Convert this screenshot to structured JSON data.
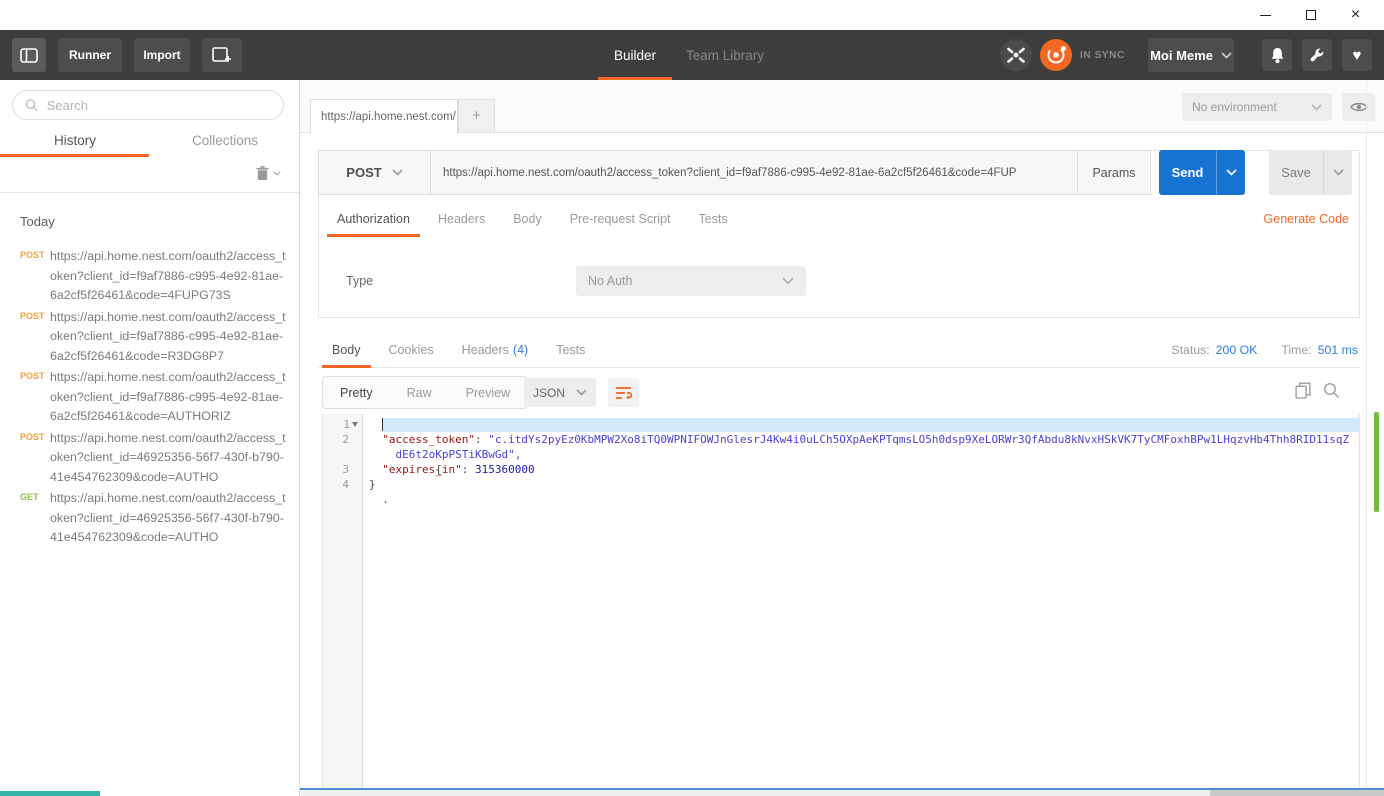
{
  "window": {
    "close_glyph": "×"
  },
  "header": {
    "runner_label": "Runner",
    "import_label": "Import",
    "builder_tab": "Builder",
    "team_library_tab": "Team Library",
    "sync_status": "IN SYNC",
    "account_name": "Moi Meme"
  },
  "sidebar": {
    "search_placeholder": "Search",
    "history_tab": "History",
    "collections_tab": "Collections",
    "section_label": "Today",
    "items": [
      {
        "method": "POST",
        "url": "https://api.home.nest.com/oauth2/access_token?client_id=f9af7886-c995-4e92-81ae-6a2cf5f26461&code=4FUPG73S"
      },
      {
        "method": "POST",
        "url": "https://api.home.nest.com/oauth2/access_token?client_id=f9af7886-c995-4e92-81ae-6a2cf5f26461&code=R3DG8P7"
      },
      {
        "method": "POST",
        "url": "https://api.home.nest.com/oauth2/access_token?client_id=f9af7886-c995-4e92-81ae-6a2cf5f26461&code=AUTHORIZ"
      },
      {
        "method": "POST",
        "url": "https://api.home.nest.com/oauth2/access_token?client_id=46925356-56f7-430f-b790-41e454762309&code=AUTHO"
      },
      {
        "method": "GET",
        "url": "https://api.home.nest.com/oauth2/access_token?client_id=46925356-56f7-430f-b790-41e454762309&code=AUTHO"
      }
    ]
  },
  "main": {
    "request_tab_title": "https://api.home.nest.com/",
    "new_tab_label": "+",
    "environment_selector": "No environment",
    "method": "POST",
    "url": "https://api.home.nest.com/oauth2/access_token?client_id=f9af7886-c995-4e92-81ae-6a2cf5f26461&code=4FUP",
    "params_label": "Params",
    "send_label": "Send",
    "save_label": "Save",
    "request_tabs": [
      "Authorization",
      "Headers",
      "Body",
      "Pre-request Script",
      "Tests"
    ],
    "generate_code_label": "Generate Code",
    "auth_type_label": "Type",
    "auth_type_value": "No Auth"
  },
  "response": {
    "body_tab": "Body",
    "cookies_tab": "Cookies",
    "headers_tab": "Headers",
    "headers_count": "(4)",
    "tests_tab": "Tests",
    "status_label": "Status:",
    "status_value": "200 OK",
    "time_label": "Time:",
    "time_value": "501 ms",
    "view_pretty": "Pretty",
    "view_raw": "Raw",
    "view_preview": "Preview",
    "format_selector": "JSON"
  },
  "editor": {
    "line1_num": "1",
    "line2_num": "2",
    "line3_num": "3",
    "line4_num": "4",
    "line1_text": "{",
    "line2_indent": "  ",
    "line2_key": "\"access_token\"",
    "line2_colon": ": ",
    "line2_string_part1": "\"c.itdYs2pyEz0KbMPW2Xo8iTQ0WPNIFOWJnGlesrJ4Kw4i0uLCh5OXpAeKPTqmsLO5h0dsp9XeLORWr3QfAbdu8kNvxHSkVK7TyCMFoxhBPw1LHqzvHb4Thh8RID11sqZ",
    "line2_wrap_indent": "    ",
    "line2_string_part2": "dE6t2oKpPSTiKBwGd\",",
    "line3_indent": "  ",
    "line3_key": "\"expires_in\"",
    "line3_colon": ": ",
    "line3_number": "315360000",
    "line4_text": "}",
    "trailing_char": "."
  },
  "colors": {
    "accent_orange": "#f26722",
    "send_blue": "#1673d2",
    "link_blue": "#2f7ed8",
    "post_badge": "#f2a23c",
    "get_badge": "#85c440",
    "header_bg": "#3d3d3d"
  }
}
